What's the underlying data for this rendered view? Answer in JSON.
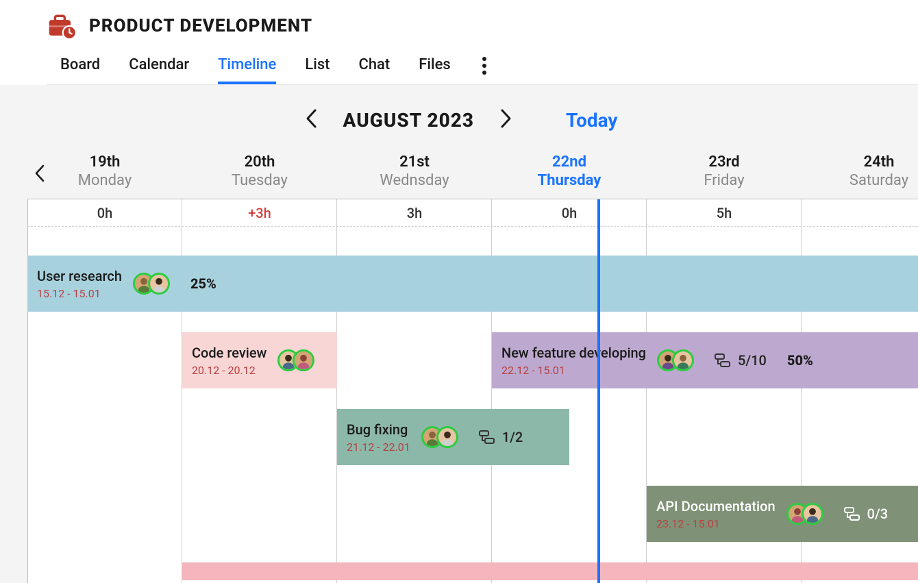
{
  "project": {
    "title": "PRODUCT DEVELOPMENT"
  },
  "tabs": {
    "items": [
      "Board",
      "Calendar",
      "Timeline",
      "List",
      "Chat",
      "Files"
    ],
    "active_index": 2
  },
  "nav": {
    "month": "AUGUST 2023",
    "today_label": "Today"
  },
  "days": [
    {
      "date": "19th",
      "name": "Monday",
      "hours": "0h",
      "over": false,
      "current": false
    },
    {
      "date": "20th",
      "name": "Tuesday",
      "hours": "+3h",
      "over": true,
      "current": false
    },
    {
      "date": "21st",
      "name": "Wednsday",
      "hours": "3h",
      "over": false,
      "current": false
    },
    {
      "date": "22nd",
      "name": "Thursday",
      "hours": "0h",
      "over": false,
      "current": true
    },
    {
      "date": "23rd",
      "name": "Friday",
      "hours": "5h",
      "over": false,
      "current": false
    },
    {
      "date": "24th",
      "name": "Saturday",
      "hours": "",
      "over": false,
      "current": false
    }
  ],
  "tasks": {
    "user_research": {
      "title": "User research",
      "dates": "15.12 - 15.01",
      "percent": "25%"
    },
    "code_review": {
      "title": "Code review",
      "dates": "20.12 - 20.12"
    },
    "bug_fixing": {
      "title": "Bug fixing",
      "dates": "21.12 - 22.01",
      "subtasks": "1/2"
    },
    "new_feature": {
      "title": "New feature developing",
      "dates": "22.12 - 15.01",
      "subtasks": "5/10",
      "percent": "50%"
    },
    "api_docs": {
      "title": "API Documentation",
      "dates": "23.12 - 15.01",
      "subtasks": "0/3"
    }
  }
}
